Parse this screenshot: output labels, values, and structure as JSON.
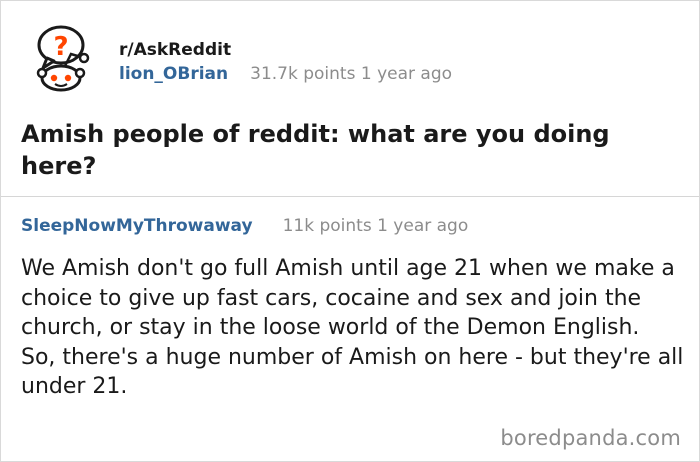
{
  "post": {
    "subreddit": "r/AskReddit",
    "username": "lion_OBrian",
    "points_time": "31.7k points 1 year ago",
    "title": "Amish people of reddit: what are you doing here?",
    "avatar_icon": "askreddit-snoo-icon"
  },
  "comment": {
    "author": "SleepNowMyThrowaway",
    "points_time": "11k points 1 year ago",
    "paragraph1": "We Amish don't go full Amish until age 21 when we make a choice to give up fast cars, cocaine and sex and join the church, or stay in the loose world of the Demon English.",
    "paragraph2": "So, there's a huge number of Amish on here - but they're all under 21."
  },
  "watermark": "boredpanda.com",
  "colors": {
    "username": "#336699",
    "meta": "#8c8c8c",
    "text": "#1a1a1a",
    "avatar_ring": "#f4b000",
    "question_mark": "#ff4500"
  }
}
